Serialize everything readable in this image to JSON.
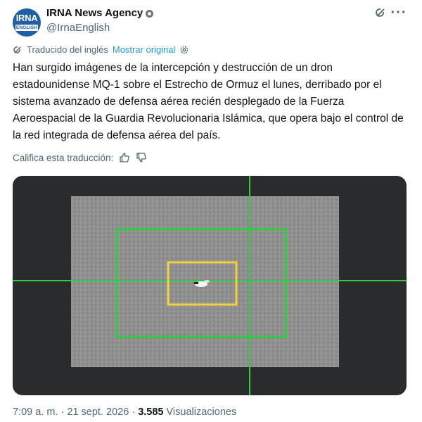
{
  "post": {
    "author": {
      "avatar_top": "IRNA",
      "avatar_bottom": "ENGLISH",
      "display_name": "IRNA News Agency",
      "handle": "@IrnaEnglish",
      "verified_icon": "verified-badge-icon"
    },
    "translation": {
      "label": "Traducido del inglés",
      "show_original": "Mostrar original"
    },
    "text": "Han surgido imágenes de la intercepción y destrucción de un dron estadounidense MQ-1 sobre el Estrecho de Ormuz el lunes, derribado por el sistema avanzado de defensa aérea recién desplegado de la Fuerza Aeroespacial de la Guardia Revolucionaria Islámica, que opera bajo el control de la red integrada de defensa aérea del país.",
    "rate_translation": "Califica esta traducción:",
    "time": "7:09 a. m.",
    "separator": "·",
    "date": "21 sept. 2026",
    "views_count": "3.585",
    "views_label": "Visualizaciones"
  },
  "colors": {
    "link": "#1d9bf0",
    "secondary_text": "#536471",
    "target_box_outer": "#2ecc40",
    "target_box_inner": "#f2d13a",
    "crosshair": "#2ecc40"
  }
}
